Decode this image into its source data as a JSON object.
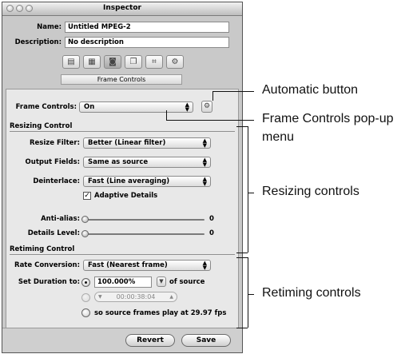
{
  "window": {
    "title": "Inspector"
  },
  "header": {
    "name_label": "Name:",
    "name_value": "Untitled MPEG-2",
    "description_label": "Description:",
    "description_value": "No description",
    "tab_icons": [
      "summary-icon",
      "encoder-icon",
      "frame-controls-icon",
      "filters-icon",
      "geometry-icon",
      "actions-icon"
    ],
    "active_tab": "Frame Controls"
  },
  "frame_controls": {
    "label": "Frame Controls:",
    "value": "On",
    "gear_icon": "gear-icon"
  },
  "resizing": {
    "title": "Resizing Control",
    "resize_filter_label": "Resize Filter:",
    "resize_filter_value": "Better (Linear filter)",
    "output_fields_label": "Output Fields:",
    "output_fields_value": "Same as source",
    "deinterlace_label": "Deinterlace:",
    "deinterlace_value": "Fast (Line averaging)",
    "adaptive_details_label": "Adaptive Details",
    "adaptive_details_checked": true,
    "anti_alias_label": "Anti-alias:",
    "anti_alias_value": "0",
    "details_level_label": "Details Level:",
    "details_level_value": "0"
  },
  "retiming": {
    "title": "Retiming Control",
    "rate_conversion_label": "Rate Conversion:",
    "rate_conversion_value": "Fast (Nearest frame)",
    "set_duration_label": "Set Duration to:",
    "percent_value": "100.000%",
    "of_source_label": "of source",
    "timecode_value": "00:00:38:04",
    "fps_label": "so source frames play at 29.97 fps"
  },
  "footer": {
    "revert_label": "Revert",
    "save_label": "Save"
  },
  "callouts": {
    "automatic_button": "Automatic button",
    "frame_controls_popup_line1": "Frame Controls pop-up",
    "frame_controls_popup_line2": "menu",
    "resizing_controls": "Resizing controls",
    "retiming_controls": "Retiming controls"
  }
}
